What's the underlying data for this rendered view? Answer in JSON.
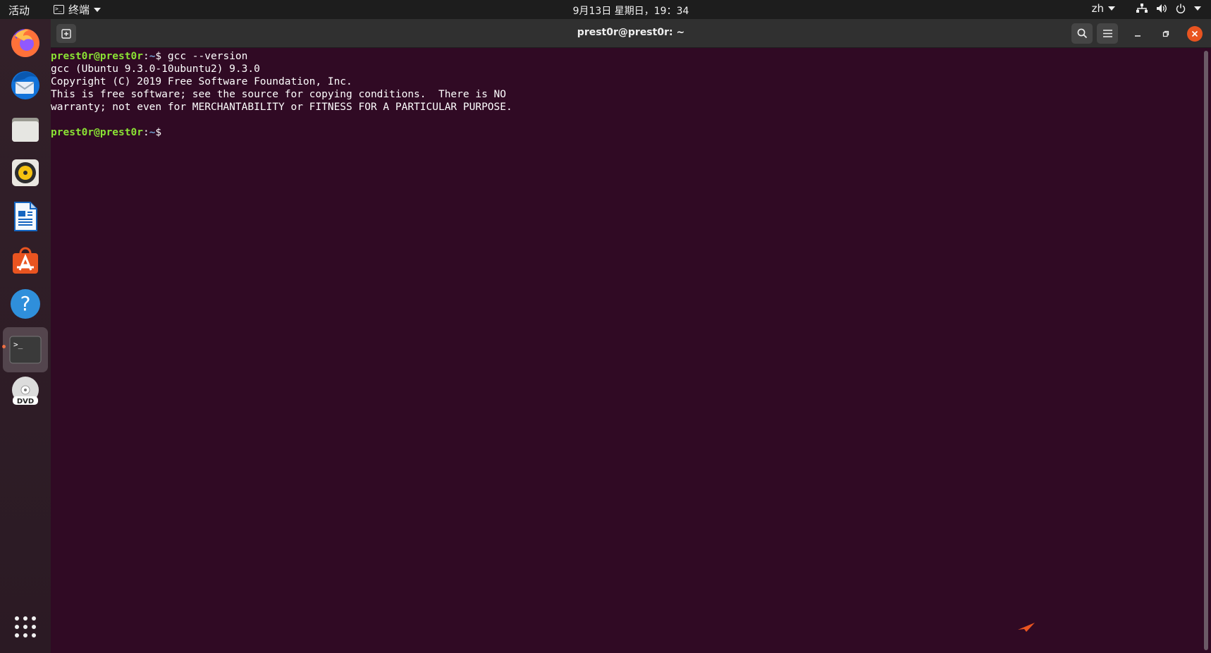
{
  "topbar": {
    "activities": "活动",
    "app_menu": "终端",
    "clock": "9月13日 星期日，19：34",
    "input_method": "zh"
  },
  "dock": {
    "items": [
      {
        "name": "firefox",
        "icon": "firefox-icon"
      },
      {
        "name": "thunderbird",
        "icon": "thunderbird-icon"
      },
      {
        "name": "files",
        "icon": "files-icon"
      },
      {
        "name": "rhythmbox",
        "icon": "rhythmbox-icon"
      },
      {
        "name": "writer",
        "icon": "libreoffice-writer-icon"
      },
      {
        "name": "software",
        "icon": "software-center-icon"
      },
      {
        "name": "help",
        "icon": "help-icon"
      },
      {
        "name": "terminal",
        "icon": "terminal-icon",
        "active": true
      },
      {
        "name": "dvd",
        "icon": "dvd-icon"
      },
      {
        "name": "apps",
        "icon": "app-grid-icon"
      }
    ]
  },
  "window": {
    "title": "prest0r@prest0r: ~"
  },
  "terminal": {
    "prompt_user": "prest0r@prest0r",
    "prompt_sep": ":",
    "prompt_path": "~",
    "prompt_end": "$ ",
    "command": "gcc --version",
    "output": [
      "gcc (Ubuntu 9.3.0-10ubuntu2) 9.3.0",
      "Copyright (C) 2019 Free Software Foundation, Inc.",
      "This is free software; see the source for copying conditions.  There is NO",
      "warranty; not even for MERCHANTABILITY or FITNESS FOR A PARTICULAR PURPOSE.",
      ""
    ],
    "prompt2_end": "$"
  },
  "colors": {
    "terminal_bg": "#300a24",
    "prompt_user": "#8ae234",
    "prompt_path": "#729fcf",
    "accent": "#e95420"
  }
}
